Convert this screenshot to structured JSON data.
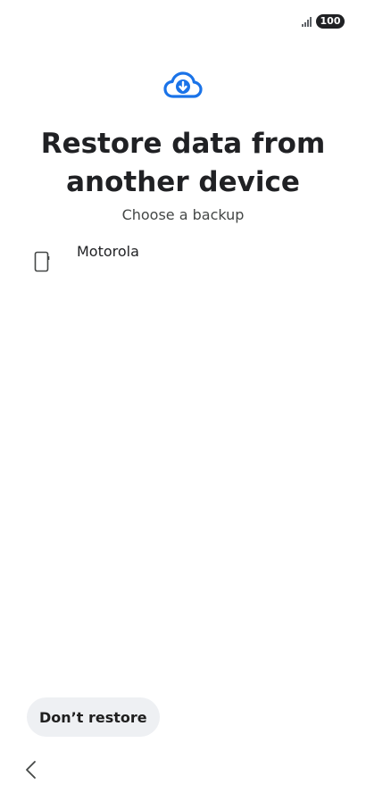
{
  "status_bar": {
    "signal_icon": "signal-bars-icon",
    "battery_level": "100"
  },
  "header": {
    "icon": "cloud-download-icon",
    "title": "Restore data from another device",
    "subtitle": "Choose a backup"
  },
  "backups": [
    {
      "icon": "phone-icon",
      "label": "Motorola"
    }
  ],
  "footer": {
    "dont_restore_label": "Don’t restore",
    "back_icon": "chevron-left-icon"
  },
  "colors": {
    "accent": "#1a73e8",
    "background": "#ffffff",
    "button_bg": "#eef0f3",
    "text": "#202124"
  }
}
